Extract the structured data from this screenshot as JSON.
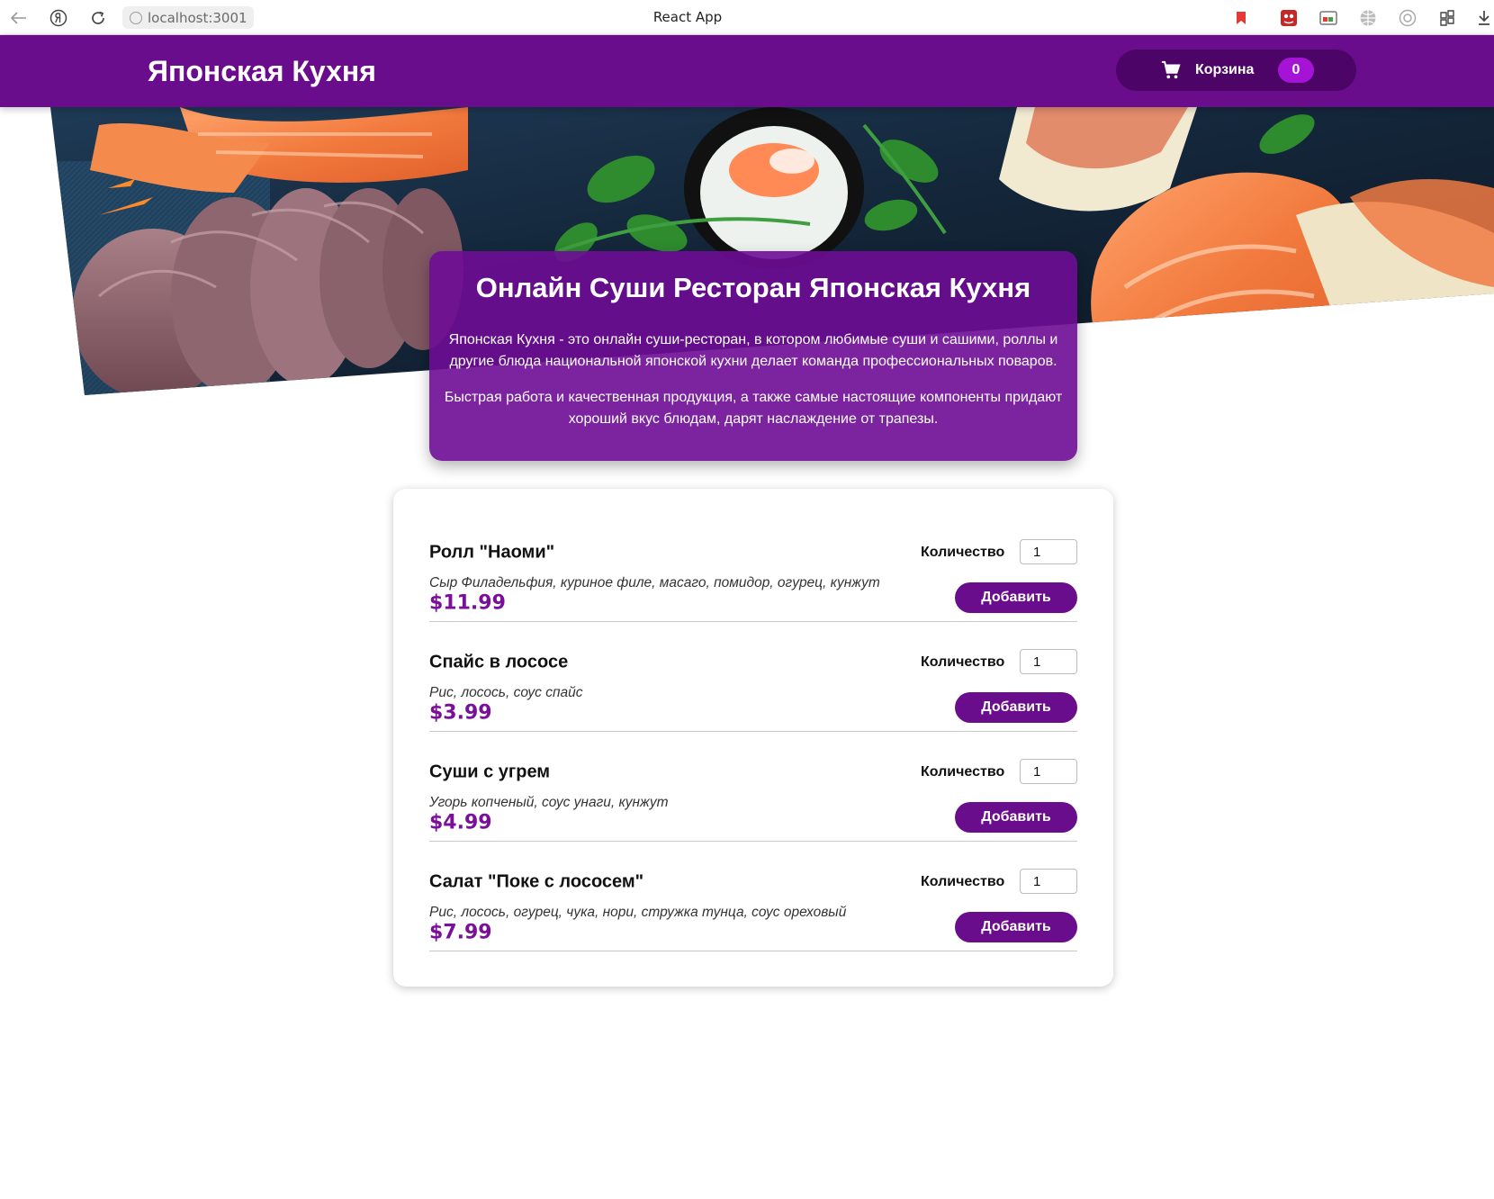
{
  "browser": {
    "url": "localhost:3001",
    "tab_title": "React App",
    "icons": [
      "back-icon",
      "yandex-icon",
      "reload-icon",
      "bookmark-icon",
      "extension-icon",
      "download-icon"
    ]
  },
  "header": {
    "logo": "Японская Кухня",
    "cart_label": "Корзина",
    "cart_count": "0",
    "colors": {
      "header_bg": "#6a0d8c",
      "cart_bg": "#4c0566",
      "badge_bg": "#a413d6"
    }
  },
  "intro": {
    "title": "Онлайн Суши Ресторан Японская Кухня",
    "paragraph1": "Японская Кухня - это онлайн суши-ресторан, в котором любимые суши и сашими, роллы и другие блюда национальной японской кухни делает команда профессиональных поваров.",
    "paragraph2": "Быстрая работа и качественная продукция, а также самые настоящие компоненты придают хороший вкус блюдам, дарят наслаждение от трапезы."
  },
  "menu": {
    "quantity_label": "Количество",
    "add_label": "Добавить",
    "items": [
      {
        "name": "Ролл \"Наоми\"",
        "description": "Сыр Филадельфия, куриное филе, масаго, помидор, огурец, кунжут",
        "price": "$11.99",
        "quantity": "1"
      },
      {
        "name": "Спайс в лососе",
        "description": "Рис, лосось, соус спайс",
        "price": "$3.99",
        "quantity": "1"
      },
      {
        "name": "Суши с угрем",
        "description": "Угорь копченый, соус унаги, кунжут",
        "price": "$4.99",
        "quantity": "1"
      },
      {
        "name": "Салат \"Поке с лососем\"",
        "description": "Рис, лосось, огурец, чука, нори, стружка тунца, соус ореховый",
        "price": "$7.99",
        "quantity": "1"
      }
    ]
  }
}
